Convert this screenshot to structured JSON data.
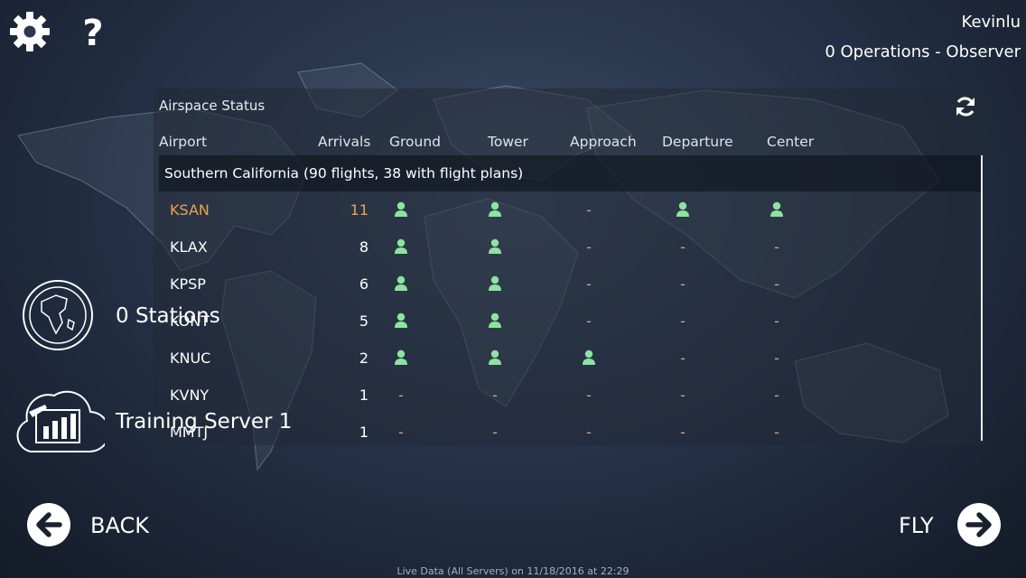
{
  "user": {
    "name": "Kevinlu",
    "status": "0 Operations - Observer"
  },
  "panel": {
    "title": "Airspace Status",
    "columns": [
      "Airport",
      "Arrivals",
      "Ground",
      "Tower",
      "Approach",
      "Departure",
      "Center"
    ],
    "region": "Southern California (90 flights, 38 with flight plans)",
    "rows": [
      {
        "code": "KSAN",
        "arrivals": "11",
        "highlight": true,
        "stations": [
          "staffed",
          "staffed",
          "-",
          "staffed",
          "staffed"
        ]
      },
      {
        "code": "KLAX",
        "arrivals": "8",
        "stations": [
          "staffed",
          "staffed",
          "-",
          "-",
          "-"
        ]
      },
      {
        "code": "KPSP",
        "arrivals": "6",
        "stations": [
          "staffed",
          "staffed",
          "-",
          "-",
          "-"
        ]
      },
      {
        "code": "KONT",
        "arrivals": "5",
        "stations": [
          "staffed",
          "staffed",
          "-",
          "-",
          "-"
        ]
      },
      {
        "code": "KNUC",
        "arrivals": "2",
        "stations": [
          "staffed",
          "staffed",
          "staffed",
          "-",
          "-"
        ]
      },
      {
        "code": "KVNY",
        "arrivals": "1",
        "stations": [
          "-",
          "-",
          "-",
          "-",
          "-"
        ]
      },
      {
        "code": "MMTJ",
        "arrivals": "1",
        "stations": [
          "-",
          "-",
          "-",
          "-",
          "-"
        ]
      }
    ],
    "empty_marker": "-"
  },
  "left": {
    "stations": "0 Stations",
    "server": "Training Server 1"
  },
  "nav": {
    "back": "BACK",
    "fly": "FLY"
  },
  "footer": "Live Data (All Servers) on 11/18/2016 at 22:29",
  "colors": {
    "highlight": "#f0a050",
    "staffed": "#8de3a0",
    "empty": "#d9a48c",
    "region_bg": "#0a0e16"
  },
  "icons": {
    "settings": "gear-icon",
    "help": "help-icon",
    "refresh": "refresh-icon",
    "globe": "globe-icon",
    "server": "server-cloud-icon",
    "back": "arrow-left-icon",
    "fly": "arrow-right-icon",
    "staffed": "person-icon"
  }
}
